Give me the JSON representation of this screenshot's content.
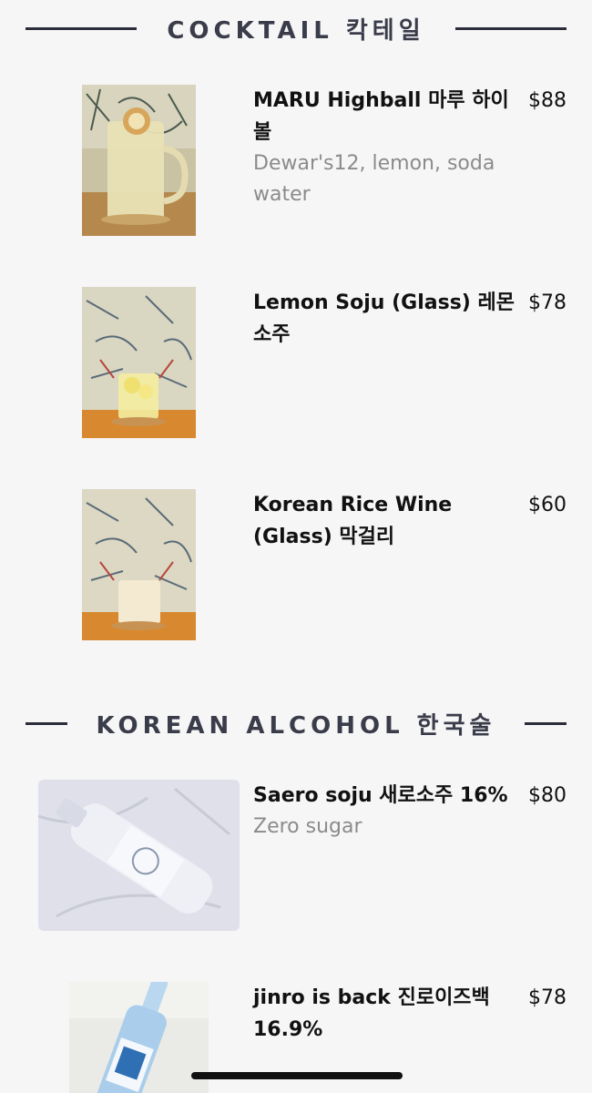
{
  "sections": [
    {
      "title": "COCKTAIL 칵테일",
      "items": [
        {
          "name": "MARU Highball 마루 하이볼",
          "price": "$88",
          "description": "Dewar's12, lemon, soda water"
        },
        {
          "name": "Lemon Soju (Glass) 레몬 소주",
          "price": "$78",
          "description": ""
        },
        {
          "name": "Korean Rice Wine (Glass) 막걸리",
          "price": "$60",
          "description": ""
        }
      ]
    },
    {
      "title": "KOREAN ALCOHOL 한국술",
      "items": [
        {
          "name": "Saero soju 새로소주 16%",
          "price": "$80",
          "description": "Zero sugar"
        },
        {
          "name": "jinro is back 진로이즈백 16.9%",
          "price": "$78",
          "description": ""
        }
      ]
    }
  ]
}
